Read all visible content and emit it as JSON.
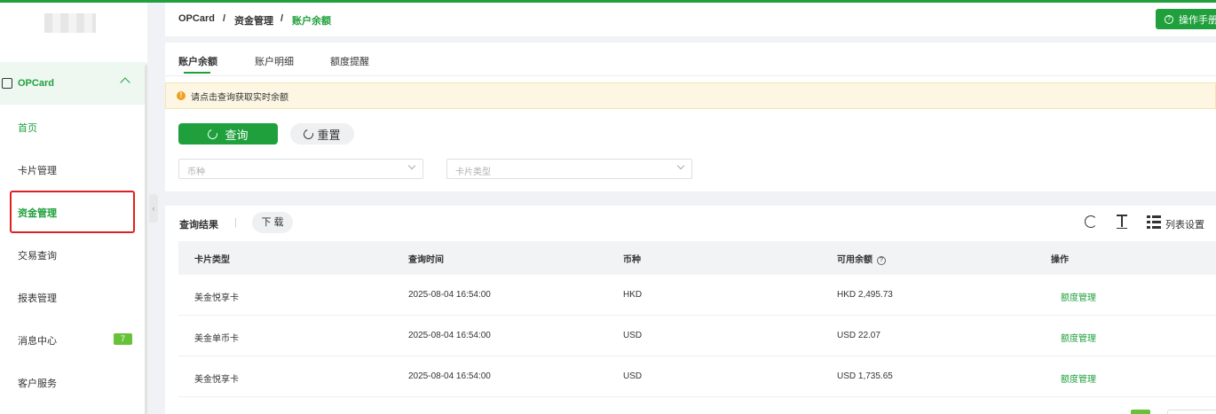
{
  "breadcrumb": {
    "root": "OPCard",
    "sep": "/",
    "parent": "资金管理",
    "current": "账户余额"
  },
  "header": {
    "manual_label": "操作手册"
  },
  "sidebar": {
    "group_label": "OPCard",
    "items": [
      {
        "label": "首页"
      },
      {
        "label": "卡片管理"
      },
      {
        "label": "资金管理"
      },
      {
        "label": "交易查询"
      },
      {
        "label": "报表管理"
      },
      {
        "label": "消息中心",
        "badge": "7"
      },
      {
        "label": "客户服务"
      }
    ]
  },
  "tabs": [
    {
      "label": "账户余额"
    },
    {
      "label": "账户明细"
    },
    {
      "label": "额度提醒"
    }
  ],
  "alert": {
    "text": "请点击查询获取实时余额"
  },
  "filters": {
    "query_label": "查询",
    "reset_label": "重置",
    "currency_placeholder": "币种",
    "card_type_placeholder": "卡片类型"
  },
  "results": {
    "title": "查询结果",
    "divider": "|",
    "download_label": "下 载",
    "column_settings_label": "列表设置"
  },
  "table": {
    "headers": [
      "卡片类型",
      "查询时间",
      "币种",
      "可用余额",
      "操作"
    ],
    "rows": [
      [
        "美金悦享卡",
        "2025-08-04 16:54:00",
        "HKD",
        "HKD 2,495.73",
        "额度管理"
      ],
      [
        "美金单币卡",
        "2025-08-04 16:54:00",
        "USD",
        "USD 22.07",
        "额度管理"
      ],
      [
        "美金悦享卡",
        "2025-08-04 16:54:00",
        "USD",
        "USD 1,735.65",
        "额度管理"
      ]
    ]
  },
  "colors": {
    "accent": "#1fa03c",
    "highlight": "#e02020",
    "alert_bg": "#fdf6e3"
  }
}
